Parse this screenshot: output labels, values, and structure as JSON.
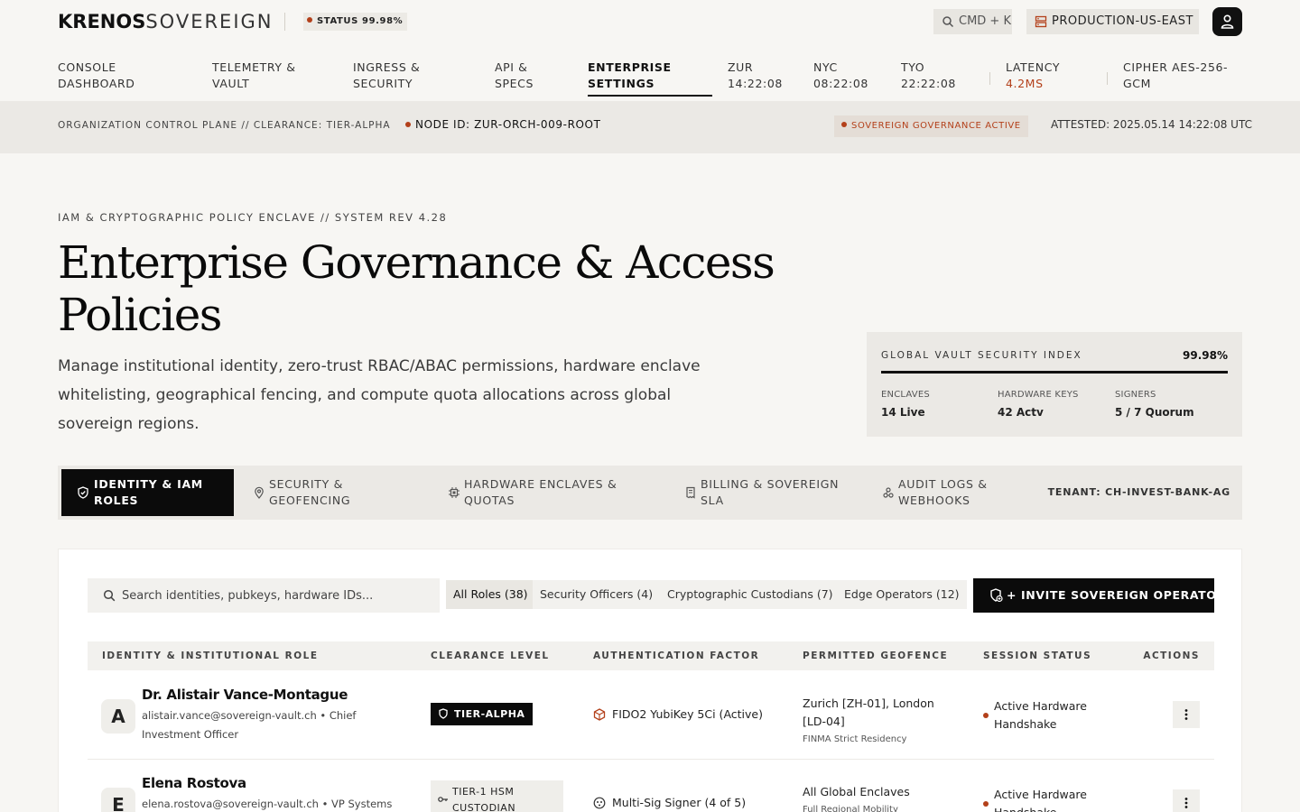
{
  "brand": {
    "name_bold": "KRENOS",
    "name_light": "SOVEREIGN"
  },
  "status": {
    "label": "STATUS 99.98%"
  },
  "topbar": {
    "search_label": "CMD + K",
    "environment": "PRODUCTION-US-EAST"
  },
  "nav": {
    "items": [
      {
        "line1": "CONSOLE",
        "line2": "DASHBOARD"
      },
      {
        "line1": "TELEMETRY &",
        "line2": "VAULT"
      },
      {
        "line1": "INGRESS &",
        "line2": "SECURITY"
      },
      {
        "line1": "API &",
        "line2": "SPECS"
      },
      {
        "line1": "ENTERPRISE",
        "line2": "SETTINGS",
        "active": true
      }
    ],
    "clocks": [
      {
        "city": "ZUR",
        "time": "14:22:08"
      },
      {
        "city": "NYC",
        "time": "08:22:08"
      },
      {
        "city": "TYO",
        "time": "22:22:08"
      }
    ],
    "latency": {
      "label": "LATENCY",
      "value": "4.2MS"
    },
    "cipher": {
      "line1": "CIPHER AES-256-",
      "line2": "GCM"
    }
  },
  "control": {
    "context": "ORGANIZATION CONTROL PLANE // CLEARANCE: TIER-ALPHA",
    "node": "NODE ID: ZUR-ORCH-009-ROOT",
    "governance": "SOVEREIGN GOVERNANCE ACTIVE",
    "attested": "ATTESTED: 2025.05.14 14:22:08 UTC"
  },
  "hero": {
    "eyebrow": "IAM & CRYPTOGRAPHIC POLICY ENCLAVE // SYSTEM REV 4.28",
    "title_line1": "Enterprise Governance & Access",
    "title_line2": "Policies",
    "description": "Manage institutional identity, zero-trust RBAC/ABAC permissions, hardware enclave whitelisting, geographical fencing, and compute quota allocations across global sovereign regions."
  },
  "index": {
    "title": "GLOBAL VAULT SECURITY INDEX",
    "value": "99.98%",
    "stats": [
      {
        "label": "ENCLAVES",
        "value": "14 Live"
      },
      {
        "label": "HARDWARE KEYS",
        "value": "42 Actv"
      },
      {
        "label": "SIGNERS",
        "value": "5 / 7 Quorum"
      }
    ]
  },
  "tabs": {
    "items": [
      {
        "line1": "IDENTITY & IAM",
        "line2": "ROLES",
        "icon": "shield-check-icon",
        "active": true
      },
      {
        "line1": "SECURITY &",
        "line2": "GEOFENCING",
        "icon": "map-pin-icon"
      },
      {
        "line1": "HARDWARE ENCLAVES &",
        "line2": "QUOTAS",
        "icon": "chip-icon"
      },
      {
        "line1": "BILLING & SOVEREIGN",
        "line2": "SLA",
        "icon": "receipt-icon"
      },
      {
        "line1": "AUDIT LOGS &",
        "line2": "WEBHOOKS",
        "icon": "webhook-icon"
      }
    ],
    "tenant": "TENANT: CH-INVEST-BANK-AG"
  },
  "directory": {
    "search_placeholder": "Search identities, pubkeys, hardware IDs...",
    "filters": [
      "All Roles (38)",
      "Security Officers (4)",
      "Cryptographic Custodians (7)",
      "Edge Operators (12)"
    ],
    "invite_label": "+ INVITE SOVEREIGN OPERATOR",
    "columns": [
      "IDENTITY & INSTITUTIONAL ROLE",
      "CLEARANCE LEVEL",
      "AUTHENTICATION FACTOR",
      "PERMITTED GEOFENCE",
      "SESSION STATUS",
      "ACTIONS"
    ],
    "rows": [
      {
        "initial": "A",
        "name": "Dr. Alistair Vance-Montague",
        "email_role": "alistair.vance@sovereign-vault.ch • Chief Investment Officer",
        "clearance": "TIER-ALPHA",
        "auth": "FIDO2 YubiKey 5Ci (Active)",
        "geofence": "Zurich [ZH-01], London [LD-04]",
        "geofence_sub": "FINMA Strict Residency",
        "session": "Active Hardware Handshake"
      },
      {
        "initial": "E",
        "name": "Elena Rostova",
        "email_role": "elena.rostova@sovereign-vault.ch • VP Systems",
        "clearance_line1": "TIER-1 HSM",
        "clearance_line2": "CUSTODIAN",
        "auth": "Multi-Sig Signer (4 of 5)",
        "geofence": "All Global Enclaves",
        "geofence_sub": "Full Regional Mobility",
        "session": "Active Hardware Handshake"
      }
    ]
  },
  "colors": {
    "accent": "#b3401a",
    "ink": "#0b0b0b",
    "background": "#f7f6f3"
  }
}
